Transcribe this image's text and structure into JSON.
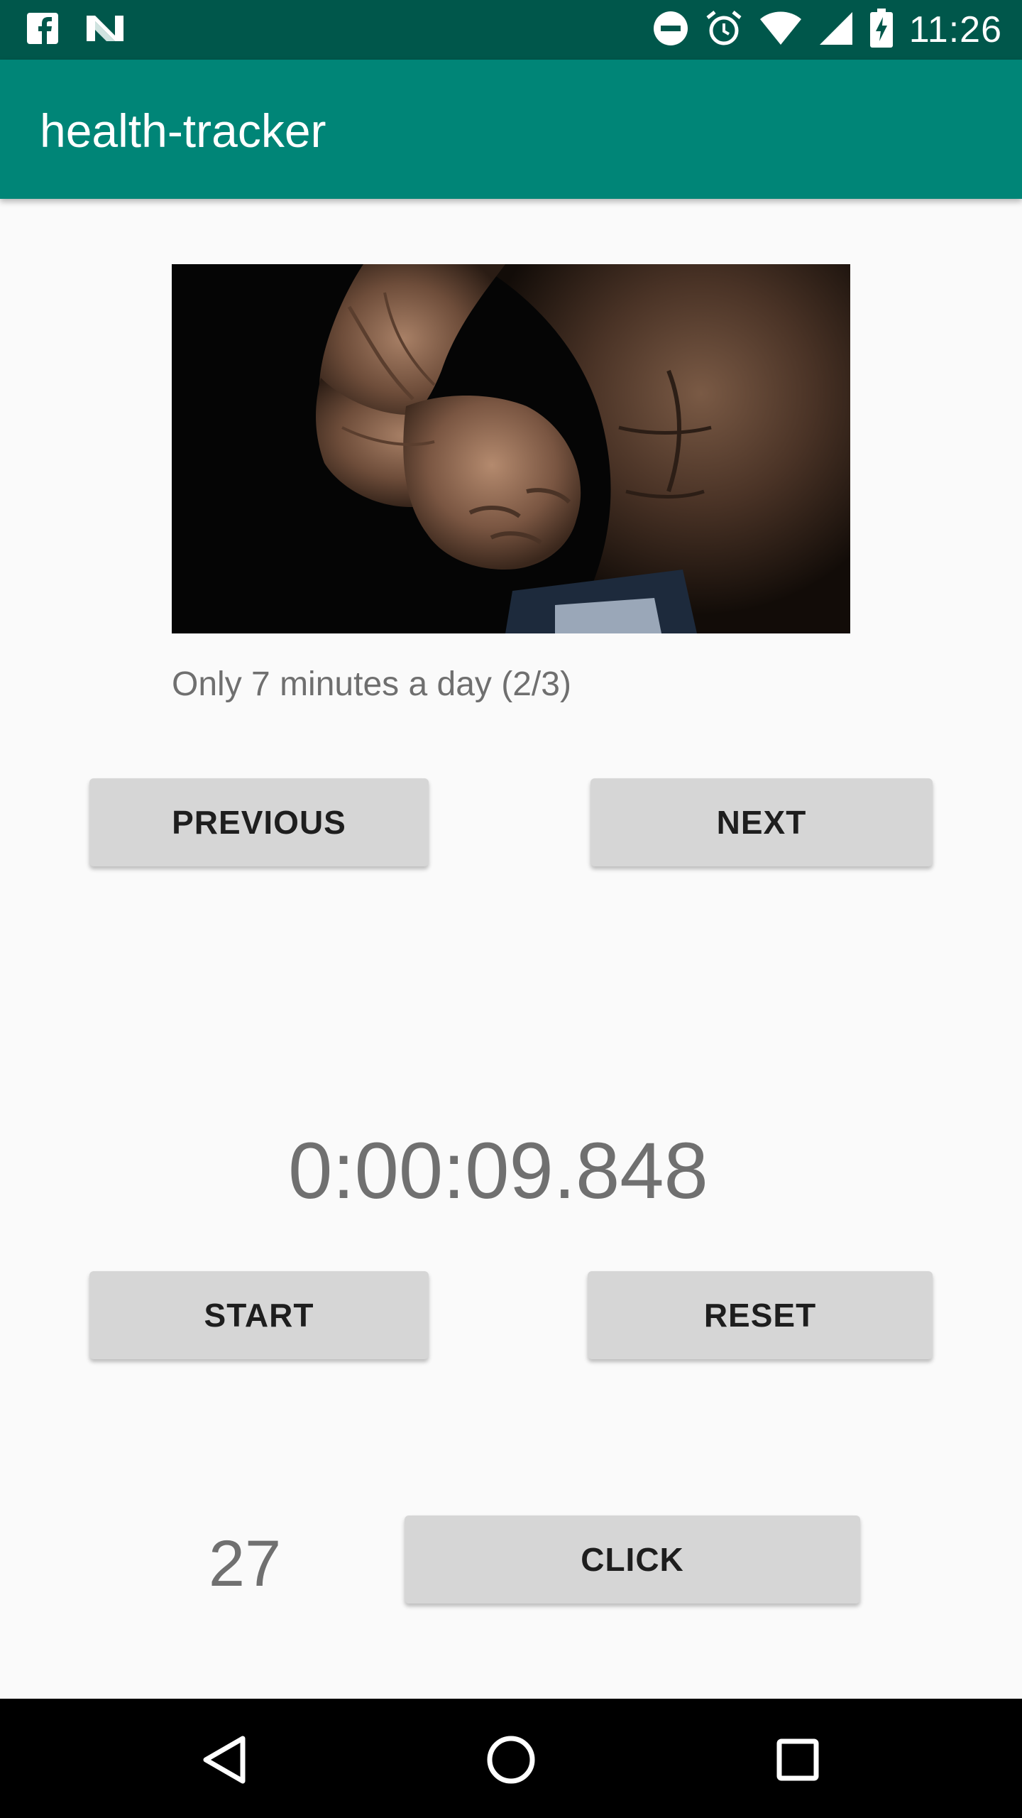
{
  "status_bar": {
    "time": "11:26",
    "icons": [
      "facebook-icon",
      "n-app-icon",
      "do-not-disturb-icon",
      "alarm-icon",
      "wifi-icon",
      "signal-icon",
      "battery-charging-icon"
    ]
  },
  "app_bar": {
    "title": "health-tracker"
  },
  "exercise": {
    "image_description": "muscular-arm-fist-photo",
    "caption": "Only 7 minutes a day (2/3)",
    "previous_label": "PREVIOUS",
    "next_label": "NEXT"
  },
  "stopwatch": {
    "time": "0:00:09.848",
    "start_label": "START",
    "reset_label": "RESET"
  },
  "clicker": {
    "count": "27",
    "click_label": "CLICK"
  },
  "nav_bar": {
    "icons": [
      "back-icon",
      "home-icon",
      "recents-icon"
    ]
  },
  "colors": {
    "status_bar": "#00574b",
    "app_bar": "#008577",
    "button_bg": "#d6d6d6",
    "background": "#fafafa"
  }
}
